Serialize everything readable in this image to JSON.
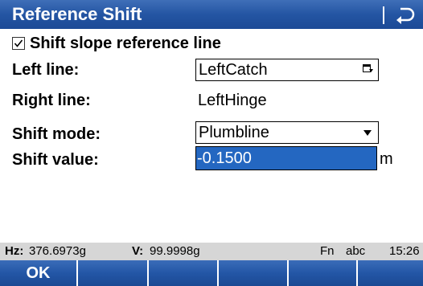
{
  "window": {
    "title": "Reference Shift",
    "back_icon": "back-arrow-icon"
  },
  "form": {
    "checkbox": {
      "label": "Shift slope reference line",
      "checked": true
    },
    "left_line": {
      "label": "Left line:",
      "value": "LeftCatch",
      "icon": "list-picker-icon"
    },
    "right_line": {
      "label": "Right line:",
      "value": "LeftHinge"
    },
    "shift_mode": {
      "label": "Shift mode:",
      "value": "Plumbline",
      "icon": "dropdown-arrow-icon"
    },
    "shift_value": {
      "label": "Shift value:",
      "value": "-0.1500",
      "unit": "m"
    }
  },
  "status": {
    "hz_label": "Hz:",
    "hz_value": "376.6973g",
    "v_label": "V:",
    "v_value": "99.9998g",
    "fn": "Fn",
    "input_mode": "abc",
    "time": "15:26"
  },
  "softkeys": [
    "OK",
    "",
    "",
    "",
    "",
    ""
  ],
  "colors": {
    "accent": "#2455a3",
    "selection": "#2467c1",
    "statusbar": "#d6d6d6"
  }
}
